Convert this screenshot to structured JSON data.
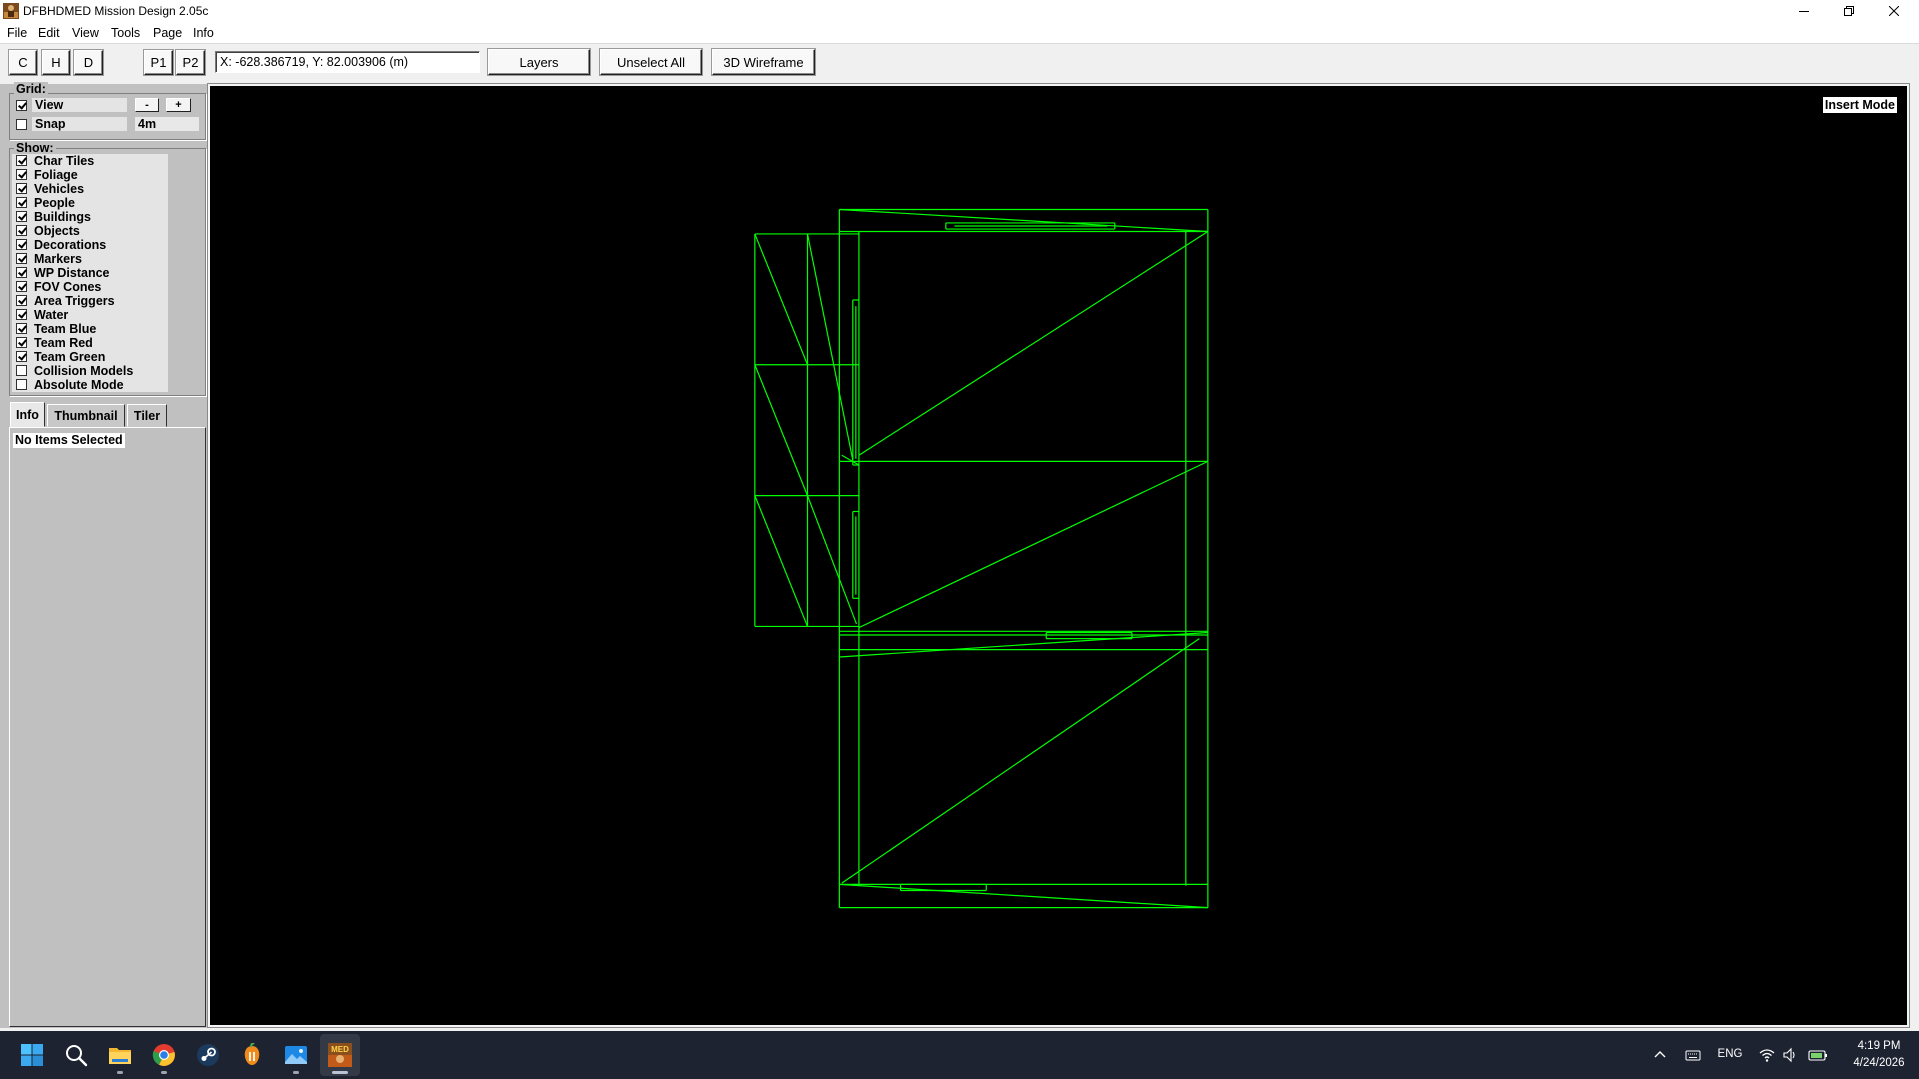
{
  "window": {
    "title": "DFBHDMED Mission Design 2.05c",
    "app_icon": "mission-design-app-icon",
    "controls": [
      {
        "icon": "minimize-icon"
      },
      {
        "icon": "restore-icon"
      },
      {
        "icon": "close-icon"
      }
    ]
  },
  "menu": [
    "File",
    "Edit",
    "View",
    "Tools",
    "Page",
    "Info"
  ],
  "toolbar": {
    "view_buttons": [
      "C",
      "H",
      "D"
    ],
    "page_buttons": [
      "P1",
      "P2"
    ],
    "coordinates": "X: -628.386719, Y: 82.003906 (m)",
    "layers": "Layers",
    "unselect_all": "Unselect All",
    "wireframe_3d": "3D Wireframe"
  },
  "grid": {
    "label": "Grid:",
    "view": {
      "label": "View",
      "checked": true
    },
    "minus": "-",
    "plus": "+",
    "snap": {
      "label": "Snap",
      "checked": false
    },
    "size": "4m"
  },
  "show": {
    "label": "Show:",
    "items": [
      {
        "label": "Char Tiles",
        "checked": true
      },
      {
        "label": "Foliage",
        "checked": true
      },
      {
        "label": "Vehicles",
        "checked": true
      },
      {
        "label": "People",
        "checked": true
      },
      {
        "label": "Buildings",
        "checked": true
      },
      {
        "label": "Objects",
        "checked": true
      },
      {
        "label": "Decorations",
        "checked": true
      },
      {
        "label": "Markers",
        "checked": true
      },
      {
        "label": "WP Distance",
        "checked": true
      },
      {
        "label": "FOV Cones",
        "checked": true
      },
      {
        "label": "Area Triggers",
        "checked": true
      },
      {
        "label": "Water",
        "checked": true
      },
      {
        "label": "Team Blue",
        "checked": true
      },
      {
        "label": "Team Red",
        "checked": true
      },
      {
        "label": "Team Green",
        "checked": true
      },
      {
        "label": "Collision Models",
        "checked": false
      },
      {
        "label": "Absolute Mode",
        "checked": false
      }
    ]
  },
  "tabs": [
    {
      "label": "Info",
      "active": true
    },
    {
      "label": "Thumbnail",
      "active": false
    },
    {
      "label": "Tiler",
      "active": false
    }
  ],
  "info_panel": {
    "text": "No Items Selected"
  },
  "canvas": {
    "mode": "Insert Mode"
  },
  "taskbar": {
    "apps": [
      {
        "icon": "windows-start-icon",
        "running": false,
        "active": false
      },
      {
        "icon": "search-icon",
        "running": false,
        "active": false
      },
      {
        "icon": "file-explorer-icon",
        "running": true,
        "active": false
      },
      {
        "icon": "chrome-icon",
        "running": true,
        "active": false
      },
      {
        "icon": "steam-icon",
        "running": false,
        "active": false
      },
      {
        "icon": "fl-studio-icon",
        "running": false,
        "active": false
      },
      {
        "icon": "photos-icon",
        "running": true,
        "active": false
      },
      {
        "icon": "mission-design-taskbar-icon",
        "label": "MED",
        "running": true,
        "active": true
      }
    ],
    "tray": {
      "icons": [
        "chevron-up-icon",
        "keyboard-icon",
        "wifi-icon",
        "volume-icon",
        "battery-icon"
      ],
      "language": "ENG",
      "time": "4:19 PM",
      "date": "4/24/2026"
    }
  },
  "colors": {
    "canvas_bg": "#000000",
    "wireframe": "#00ff00",
    "panel_bg": "#c0c0c0",
    "insert_mode_bg": "#ffffff",
    "taskbar_bg": "#1d2331"
  }
}
